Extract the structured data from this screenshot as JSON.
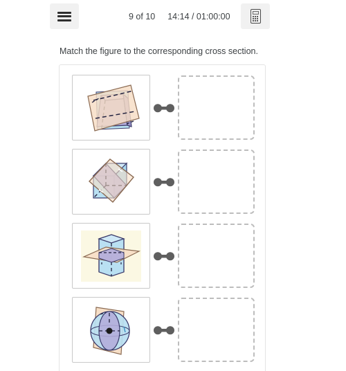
{
  "toolbar": {
    "menu_button_label": "Menu",
    "menu_icon": "hamburger-icon",
    "calculator_button_label": "Calculator",
    "calculator_icon": "calculator-icon",
    "progress": "9 of 10",
    "timer": "14:14 / 01:00:00"
  },
  "question": {
    "prompt": "Match the figure to the corresponding cross section.",
    "rows": [
      {
        "figure_name": "rectangular-frustum-with-oblique-plane",
        "figure_description": "Frustum (truncated pyramid) intersected by a tilted peach plane",
        "connector_name": "match-connector",
        "dropzone_name": "cross-section-dropzone",
        "dropzone_value": ""
      },
      {
        "figure_name": "cube-with-diagonal-plane",
        "figure_description": "Cube intersected by a tilted peach rectangular plane",
        "connector_name": "match-connector",
        "dropzone_name": "cross-section-dropzone",
        "dropzone_value": ""
      },
      {
        "figure_name": "hexagonal-prism-with-horizontal-plane",
        "figure_description": "Hexagonal prism intersected by a horizontal peach plane",
        "connector_name": "match-connector",
        "dropzone_name": "cross-section-dropzone",
        "dropzone_value": ""
      },
      {
        "figure_name": "sphere-with-vertical-plane",
        "figure_description": "Sphere intersected by a vertical peach plane",
        "connector_name": "match-connector",
        "dropzone_name": "cross-section-dropzone",
        "dropzone_value": ""
      }
    ]
  },
  "colors": {
    "plane": "#f7ddc4",
    "plane_stroke": "#8a6a52",
    "solid_purple": "#b3acdb",
    "solid_blue": "#b9e0f2",
    "solid_stroke": "#3b3b6b",
    "connector": "#5f5f5f",
    "dropzone_border": "#bdbdbd",
    "button_bg": "#f1f1f1",
    "text": "#3c4043"
  }
}
